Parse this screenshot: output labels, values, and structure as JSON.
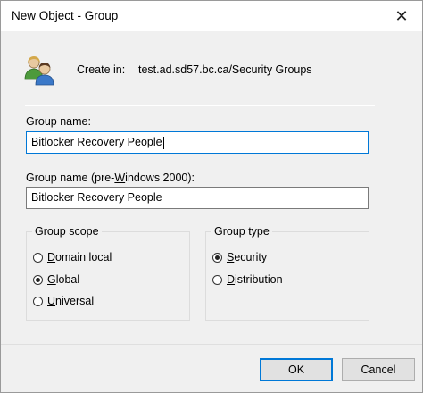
{
  "window": {
    "title": "New Object - Group",
    "close_glyph": "✕"
  },
  "header": {
    "icon": "users-icon",
    "create_in_label": "Create in:",
    "create_in_path": "test.ad.sd57.bc.ca/Security Groups"
  },
  "form": {
    "group_name_label": "Group name:",
    "group_name_value": "Bitlocker Recovery People",
    "group_name_pre2000_label_a": "Group name (pre-",
    "group_name_pre2000_label_u": "W",
    "group_name_pre2000_label_b": "indows 2000):",
    "group_name_pre2000_value": "Bitlocker Recovery People"
  },
  "group_scope": {
    "title": "Group scope",
    "options": [
      {
        "u": "D",
        "rest": "omain local",
        "checked": false
      },
      {
        "u": "G",
        "rest": "lobal",
        "checked": true
      },
      {
        "u": "U",
        "rest": "niversal",
        "checked": false
      }
    ]
  },
  "group_type": {
    "title": "Group type",
    "options": [
      {
        "u": "S",
        "rest": "ecurity",
        "checked": true
      },
      {
        "u": "D",
        "rest": "istribution",
        "checked": false
      }
    ]
  },
  "buttons": {
    "ok": "OK",
    "cancel": "Cancel"
  },
  "colors": {
    "accent": "#0078d7",
    "window_bg": "#f0f0f0"
  }
}
